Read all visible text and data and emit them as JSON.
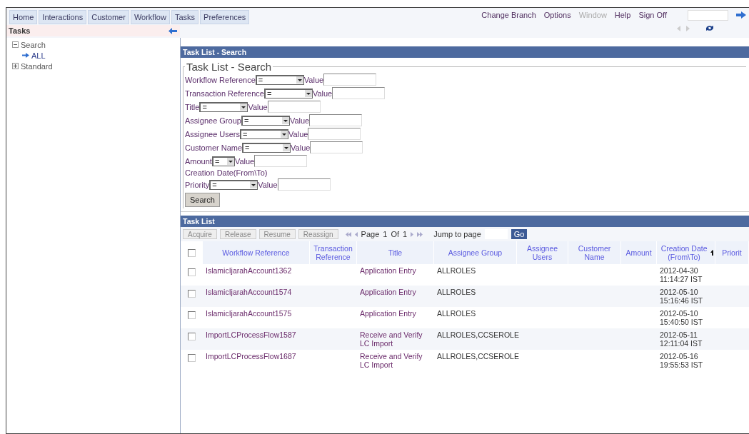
{
  "menu": [
    "Home",
    "Interactions",
    "Customer",
    "Workflow",
    "Tasks",
    "Preferences"
  ],
  "top_links": [
    {
      "label": "Change Branch",
      "disabled": false
    },
    {
      "label": "Options",
      "disabled": false
    },
    {
      "label": "Window",
      "disabled": true
    },
    {
      "label": "Help",
      "disabled": false
    },
    {
      "label": "Sign Off",
      "disabled": false
    }
  ],
  "sidebar": {
    "title": "Tasks",
    "tree": [
      {
        "label": "Search",
        "expanded": true,
        "children": [
          {
            "label": "ALL"
          }
        ]
      },
      {
        "label": "Standard",
        "expanded": false
      }
    ]
  },
  "search_panel": {
    "header": "Task List - Search",
    "legend": "Task List - Search",
    "fields": [
      {
        "kind": "filter",
        "label": "Workflow Reference",
        "operator": "=",
        "value_label": "Value"
      },
      {
        "kind": "filter",
        "label": "Transaction Reference",
        "operator": "=",
        "value_label": "Value"
      },
      {
        "kind": "filter",
        "label": "Title",
        "operator": "=",
        "value_label": "Value"
      },
      {
        "kind": "filter",
        "label": "Assignee Group",
        "operator": "=",
        "value_label": "Value"
      },
      {
        "kind": "filter",
        "label": "Assignee Users",
        "operator": "=",
        "value_label": "Value"
      },
      {
        "kind": "filter",
        "label": "Customer Name",
        "operator": "=",
        "value_label": "Value"
      },
      {
        "kind": "filter",
        "label": "Amount",
        "operator": "=",
        "value_label": "Value"
      },
      {
        "kind": "heading",
        "label": "Creation Date(From\\To)"
      },
      {
        "kind": "filter",
        "label": "Priority",
        "operator": "=",
        "value_label": "Value"
      }
    ],
    "button": "Search"
  },
  "task_list": {
    "header": "Task List",
    "actions": [
      {
        "label": "Acquire",
        "disabled": true
      },
      {
        "label": "Release",
        "disabled": true
      },
      {
        "label": "Resume",
        "disabled": true
      },
      {
        "label": "Reassign",
        "disabled": true
      }
    ],
    "pager": {
      "page_label": "Page",
      "page": "1",
      "of_label": "Of",
      "total": "1",
      "jump_label": "Jump to page",
      "go": "Go"
    },
    "all_checked": false,
    "columns": [
      {
        "label": "Workflow Reference",
        "sorted": false
      },
      {
        "label": "Transaction Reference",
        "sorted": false
      },
      {
        "label": "Title",
        "sorted": false
      },
      {
        "label": "Assignee Group",
        "sorted": false
      },
      {
        "label": "Assignee Users",
        "sorted": false
      },
      {
        "label": "Customer Name",
        "sorted": false
      },
      {
        "label": "Amount",
        "sorted": false
      },
      {
        "label": "Creation Date (From\\To)",
        "sorted": true
      },
      {
        "label": "Priorit",
        "sorted": false
      }
    ],
    "rows": [
      {
        "checked": false,
        "cells": [
          "IslamicIjarahAccount1362",
          "",
          "Application Entry",
          "ALLROLES",
          "",
          "",
          "",
          "2012-04-30 11:14:27 IST",
          ""
        ]
      },
      {
        "checked": false,
        "cells": [
          "IslamicIjarahAccount1574",
          "",
          "Application Entry",
          "ALLROLES",
          "",
          "",
          "",
          "2012-05-10 15:16:46 IST",
          ""
        ]
      },
      {
        "checked": false,
        "cells": [
          "IslamicIjarahAccount1575",
          "",
          "Application Entry",
          "ALLROLES",
          "",
          "",
          "",
          "2012-05-10 15:40:50 IST",
          ""
        ]
      },
      {
        "checked": false,
        "cells": [
          "ImportLCProcessFlow1587",
          "",
          "Receive and Verify LC Import",
          "ALLROLES,CCSEROLE",
          "",
          "",
          "",
          "2012-05-11 12:11:04 IST",
          ""
        ]
      },
      {
        "checked": false,
        "cells": [
          "ImportLCProcessFlow1687",
          "",
          "Receive and Verify LC Import",
          "ALLROLES,CCSEROLE",
          "",
          "",
          "",
          "2012-05-16 19:55:53 IST",
          ""
        ]
      }
    ]
  }
}
